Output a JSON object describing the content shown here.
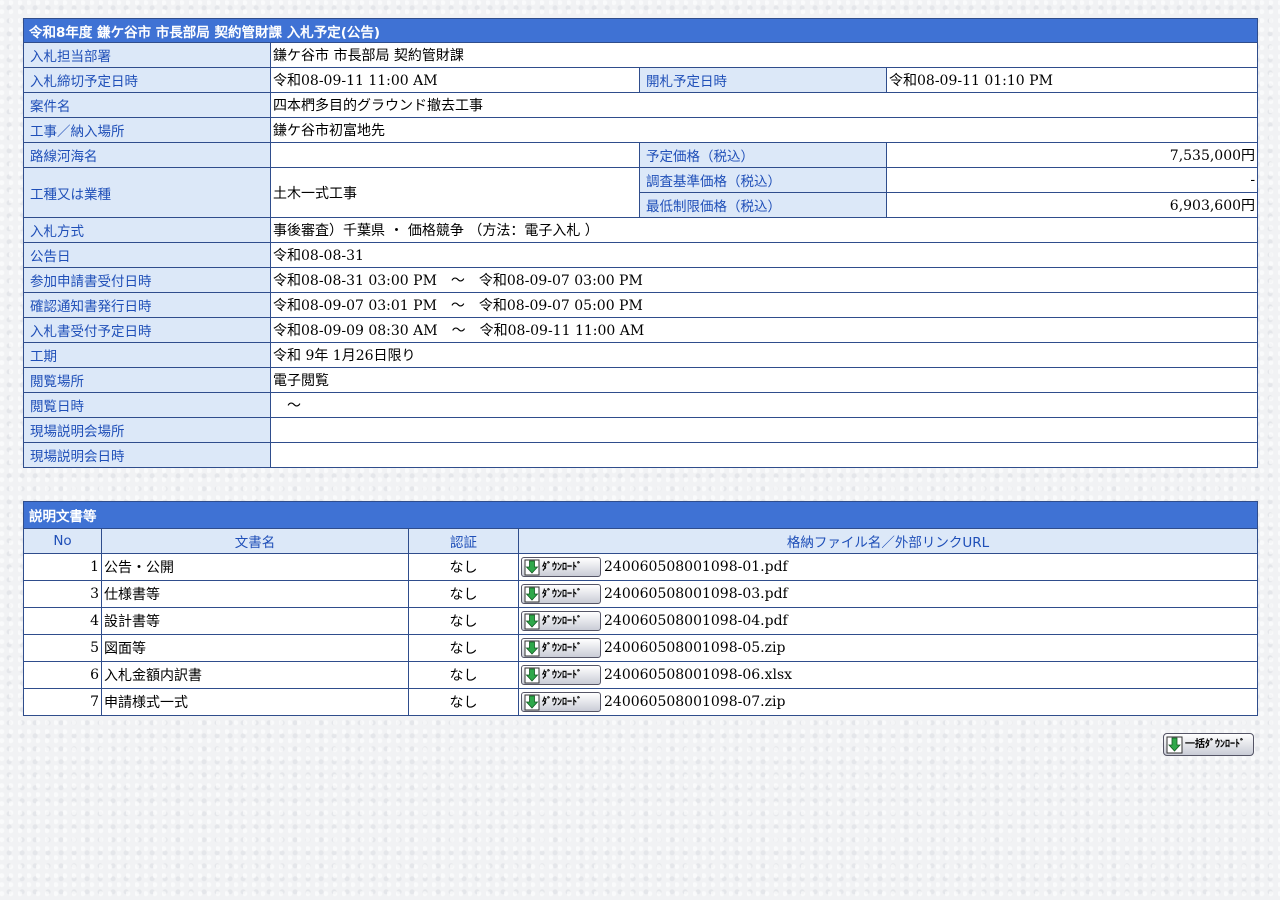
{
  "info": {
    "title": "令和8年度 鎌ケ谷市 市長部局 契約管財課 入札予定(公告)",
    "dept_label": "入札担当部署",
    "dept_value": "鎌ケ谷市 市長部局 契約管財課",
    "deadline_label": "入札締切予定日時",
    "deadline_value": "令和08-09-11 11:00 AM",
    "open_label": "開札予定日時",
    "open_value": "令和08-09-11 01:10 PM",
    "case_label": "案件名",
    "case_value": "四本椚多目的グラウンド撤去工事",
    "place_label": "工事／納入場所",
    "place_value": "鎌ケ谷市初富地先",
    "route_label": "路線河海名",
    "route_value": "",
    "price_label": "予定価格（税込）",
    "price_value": "7,535,000円",
    "type_label": "工種又は業種",
    "type_value": "土木一式工事",
    "survey_label": "調査基準価格（税込）",
    "survey_value": "-",
    "min_label": "最低制限価格（税込）",
    "min_value": "6,903,600円",
    "method_label": "入札方式",
    "method_value": "事後審査）千葉県 ・ 価格競争 （方法：電子入札 ）",
    "notice_label": "公告日",
    "notice_value": "令和08-08-31",
    "apply_label": "参加申請書受付日時",
    "apply_value": "令和08-08-31 03:00 PM　～　令和08-09-07 03:00 PM",
    "confirm_label": "確認通知書発行日時",
    "confirm_value": "令和08-09-07 03:01 PM　～　令和08-09-07 05:00 PM",
    "receipt_label": "入札書受付予定日時",
    "receipt_value": "令和08-09-09 08:30 AM　～　令和08-09-11 11:00 AM",
    "period_label": "工期",
    "period_value": "令和 9年 1月26日限り",
    "view_place_label": "閲覧場所",
    "view_place_value": "電子閲覧",
    "view_date_label": "閲覧日時",
    "view_date_value": "　～",
    "site_place_label": "現場説明会場所",
    "site_place_value": "",
    "site_date_label": "現場説明会日時",
    "site_date_value": ""
  },
  "docs": {
    "title": "説明文書等",
    "headers": {
      "no": "No",
      "name": "文書名",
      "auth": "認証",
      "file": "格納ファイル名／外部リンクURL"
    },
    "download_label": "ﾀﾞｳﾝﾛｰﾄﾞ",
    "rows": [
      {
        "no": "1",
        "name": "公告・公開",
        "auth": "なし",
        "file": "240060508001098-01.pdf"
      },
      {
        "no": "3",
        "name": "仕様書等",
        "auth": "なし",
        "file": "240060508001098-03.pdf"
      },
      {
        "no": "4",
        "name": "設計書等",
        "auth": "なし",
        "file": "240060508001098-04.pdf"
      },
      {
        "no": "5",
        "name": "図面等",
        "auth": "なし",
        "file": "240060508001098-05.zip"
      },
      {
        "no": "6",
        "name": "入札金額内訳書",
        "auth": "なし",
        "file": "240060508001098-06.xlsx"
      },
      {
        "no": "7",
        "name": "申請様式一式",
        "auth": "なし",
        "file": "240060508001098-07.zip"
      }
    ]
  },
  "bulk_download_label": "一括ﾀﾞｳﾝﾛｰﾄﾞ",
  "colors": {
    "header_blue": "#3f72d4",
    "label_bg": "#dce8f8",
    "label_text": "#1f4fb8",
    "border": "#2f4d8c"
  }
}
